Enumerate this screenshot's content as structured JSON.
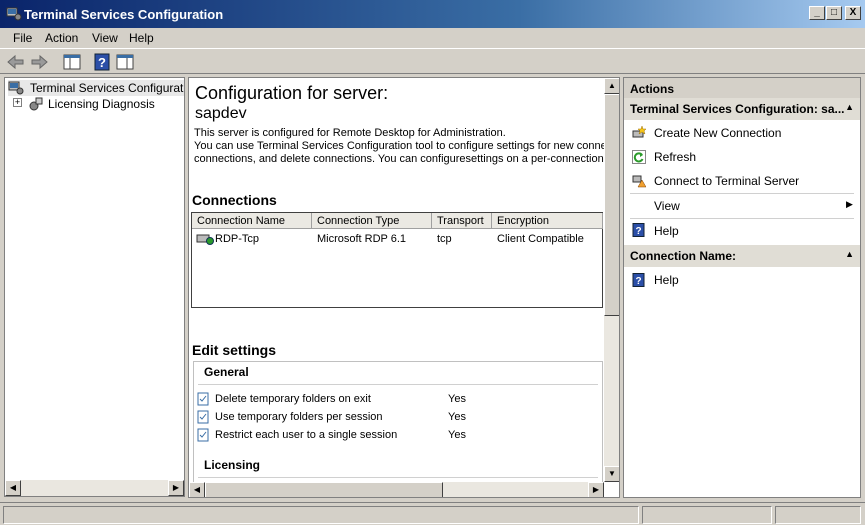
{
  "window": {
    "title": "Terminal Services Configuration",
    "controls": {
      "minimize": "_",
      "maximize": "□",
      "close": "X"
    }
  },
  "menu": {
    "items": [
      "File",
      "Action",
      "View",
      "Help"
    ]
  },
  "toolbar": {
    "buttons": [
      "back-icon",
      "forward-icon",
      "show-hide-console-tree-icon",
      "help-icon",
      "show-hide-action-pane-icon"
    ]
  },
  "tree": {
    "root": "Terminal Services Configuration:",
    "children": [
      {
        "label": "Licensing Diagnosis",
        "expander": "+"
      }
    ]
  },
  "center": {
    "heading": "Configuration for server:",
    "server": "sapdev",
    "desc_lines": [
      "This server is configured for Remote Desktop for Administration.",
      "You can use Terminal Services Configuration tool to configure settings for new connect",
      "connections, and delete connections. You can configuresettings on a per-connection b"
    ],
    "connections_title": "Connections",
    "columns": [
      "Connection Name",
      "Connection Type",
      "Transport",
      "Encryption"
    ],
    "rows": [
      {
        "name": "RDP-Tcp",
        "type": "Microsoft RDP 6.1",
        "transport": "tcp",
        "encryption": "Client Compatible"
      }
    ],
    "edit_title": "Edit settings",
    "general_title": "General",
    "general_settings": [
      {
        "label": "Delete temporary folders on exit",
        "value": "Yes"
      },
      {
        "label": "Use temporary folders per session",
        "value": "Yes"
      },
      {
        "label": "Restrict each user to a single session",
        "value": "Yes"
      }
    ],
    "licensing_title": "Licensing"
  },
  "actions": {
    "header": "Actions",
    "group1_title": "Terminal Services Configuration: sa...",
    "group1_items": [
      {
        "label": "Create New Connection",
        "icon": "create-connection-icon"
      },
      {
        "label": "Refresh",
        "icon": "refresh-icon"
      },
      {
        "label": "Connect to Terminal Server",
        "icon": "connect-server-icon"
      },
      {
        "label": "View",
        "icon": ""
      },
      {
        "label": "Help",
        "icon": "help-icon"
      }
    ],
    "group2_title": "Connection Name:",
    "group2_items": [
      {
        "label": "Help",
        "icon": "help-icon"
      }
    ]
  }
}
